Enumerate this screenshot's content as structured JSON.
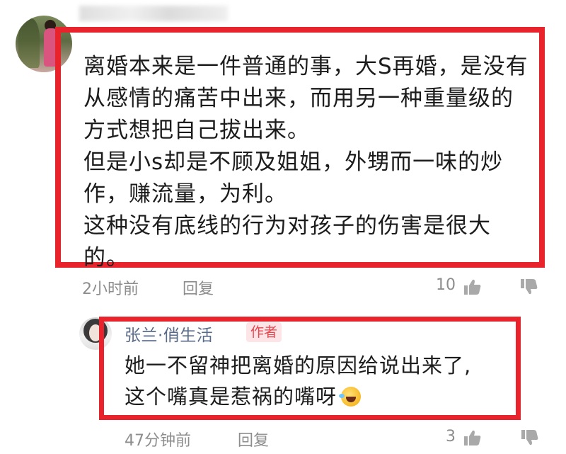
{
  "comment": {
    "lines": [
      "离婚本来是一件普通的事，大S再婚，是没有",
      "从感情的痛苦中出来，而用另一种重量级的",
      "方式想把自己拔出来。",
      "但是小s却是不顾及姐姐，外甥而一味的炒",
      "作，赚流量，为利。",
      "这种没有底线的行为对孩子的伤害是很大",
      "的。"
    ],
    "time": "2小时前",
    "reply_label": "回复",
    "likes": "10"
  },
  "reply": {
    "author": "张兰·俏生活",
    "badge": "作者",
    "lines": [
      "她一不留神把离婚的原因给说出来了,",
      "这个嘴真是惹祸的嘴呀"
    ],
    "emoji": "laughing-tears-emoji",
    "time": "47分钟前",
    "reply_label": "回复",
    "likes": "3"
  },
  "colors": {
    "highlight_border": "#e8232b",
    "meta_text": "#8d8d8d",
    "author_name": "#5a6b8a",
    "badge_text": "#e8464f",
    "badge_bg": "#fde5e7"
  }
}
